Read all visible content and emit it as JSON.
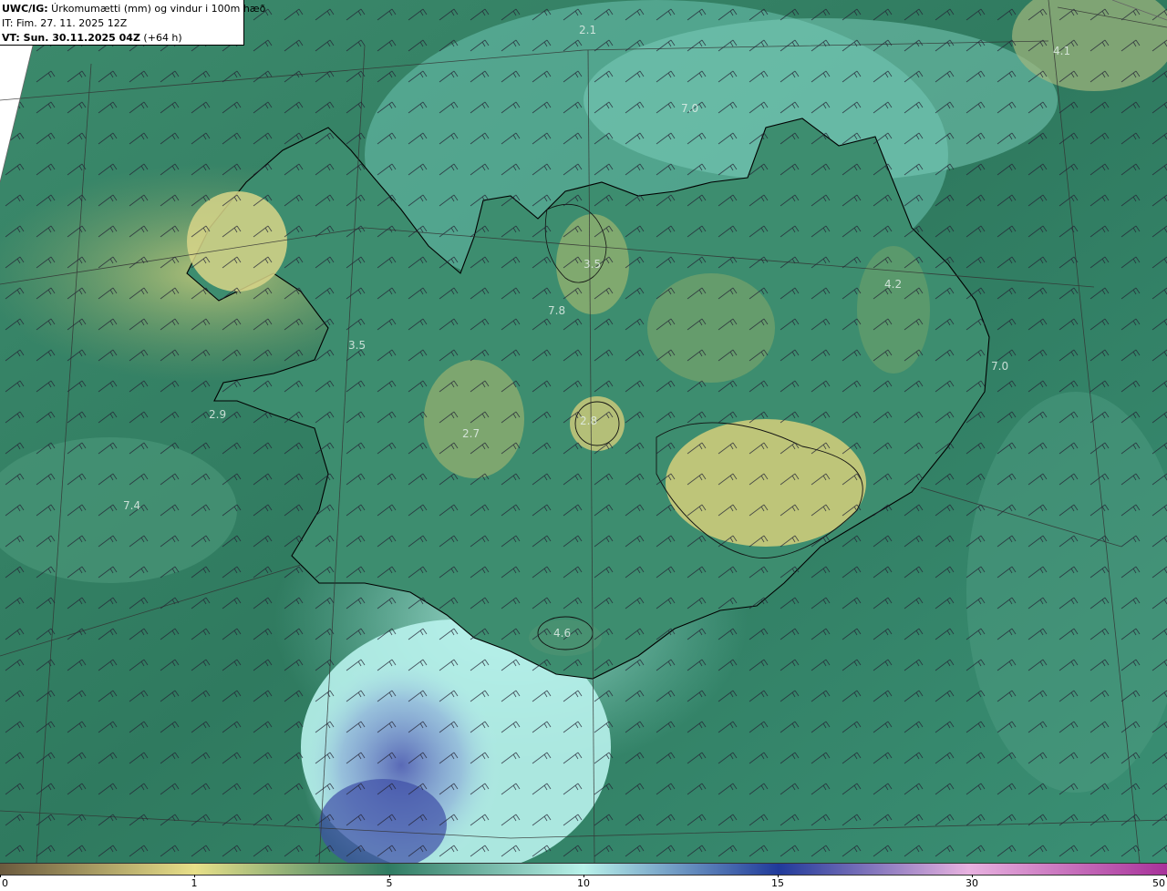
{
  "header": {
    "model_prefix": "UWC/IG:",
    "parameter": " Úrkomumætti (mm) og vindur i 100m hæð",
    "initial_time": "IT: Fim. 27. 11. 2025 12Z",
    "valid_prefix": "VT: Sun. 30.11.2025 04Z",
    "valid_suffix": " (+64 h)"
  },
  "map": {
    "region": "Iceland",
    "field_values": [
      "2.1",
      "4.1",
      "7.0",
      "3.5",
      "4.2",
      "7.8",
      "3.5",
      "7.0",
      "2.9",
      "2.8",
      "2.7",
      "7.4",
      "4.6"
    ]
  },
  "colorbar": {
    "ticks": [
      "0",
      "1",
      "5",
      "10",
      "15",
      "30",
      "50"
    ],
    "colors": {
      "dry": "#6b5a3e",
      "low": "#e8e089",
      "mid": "#2f7b62",
      "wet": "#b9f2ea",
      "heavy": "#203a9a",
      "extreme": "#a8329a"
    }
  }
}
